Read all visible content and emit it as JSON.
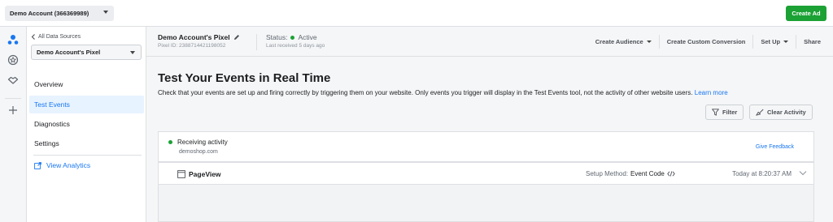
{
  "topbar": {
    "account_label": "Demo Account (366369989)",
    "create_ad_label": "Create Ad",
    "create_ad_color": "#1ca135"
  },
  "rail": {
    "icons": [
      "events-manager-icon",
      "badge-icon",
      "handshake-icon",
      "plus-icon"
    ]
  },
  "sidebar": {
    "back_label": "All Data Sources",
    "pixel_select_value": "Demo Account's Pixel",
    "items": [
      {
        "label": "Overview",
        "active": false
      },
      {
        "label": "Test Events",
        "active": true
      },
      {
        "label": "Diagnostics",
        "active": false
      },
      {
        "label": "Settings",
        "active": false
      }
    ],
    "analytics_label": "View Analytics"
  },
  "pixel_header": {
    "name": "Demo Account's Pixel",
    "pixel_id": "Pixel ID: 2388714421198052",
    "status_prefix": "Status:",
    "status_value": "Active",
    "last_received": "Last received 5 days ago",
    "actions": {
      "create_audience": "Create Audience",
      "create_conversion": "Create Custom Conversion",
      "set_up": "Set Up",
      "share": "Share"
    }
  },
  "main": {
    "title": "Test Your Events in Real Time",
    "description": "Check that your events are set up and firing correctly by triggering them on your website. Only events you trigger will display in the Test Events tool, not the activity of other website users.",
    "learn_more": "Learn more",
    "filter_label": "Filter",
    "clear_label": "Clear Activity",
    "activity": {
      "status": "Receiving activity",
      "domain": "demoshop.com",
      "feedback": "Give Feedback"
    },
    "event": {
      "name": "PageView",
      "method_label": "Setup Method:",
      "method_value": "Event Code",
      "time": "Today at 8:20:37 AM"
    }
  },
  "colors": {
    "accent": "#1877f2",
    "active_green": "#1ca135"
  }
}
